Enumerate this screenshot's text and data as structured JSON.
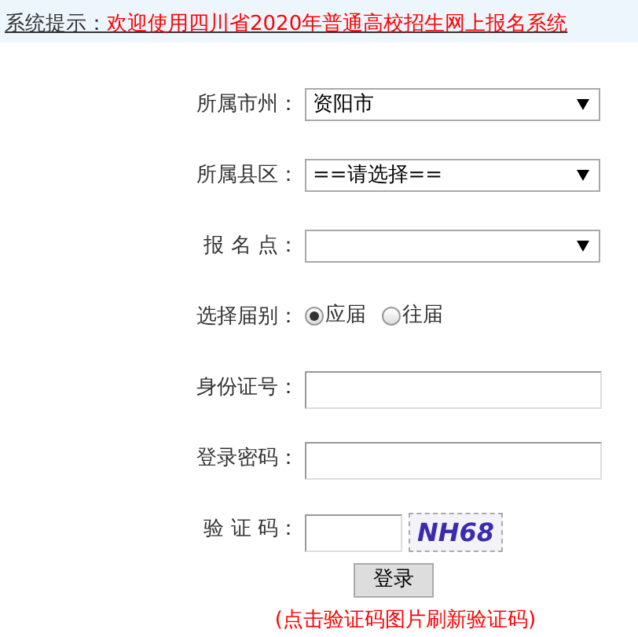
{
  "notice": {
    "label": "系统提示：",
    "message": "欢迎使用四川省2020年普通高校招生网上报名系统"
  },
  "fields": [
    {
      "kind": "select",
      "label": "所属市州：",
      "value": "资阳市"
    },
    {
      "kind": "select",
      "label": "所属县区：",
      "value": "==请选择=="
    },
    {
      "kind": "select",
      "label": "报 名 点："
    },
    {
      "kind": "radio",
      "label": "选择届别：",
      "options": [
        {
          "label": "应届",
          "selected": true
        },
        {
          "label": "往届",
          "selected": false
        }
      ]
    },
    {
      "kind": "text",
      "label": "身份证号："
    },
    {
      "kind": "text",
      "label": "登录密码："
    },
    {
      "kind": "captcha",
      "label": "验 证 码：",
      "captcha": "NH68"
    }
  ],
  "login_button": "登录",
  "hint": "(点击验证码图片刷新验证码)"
}
